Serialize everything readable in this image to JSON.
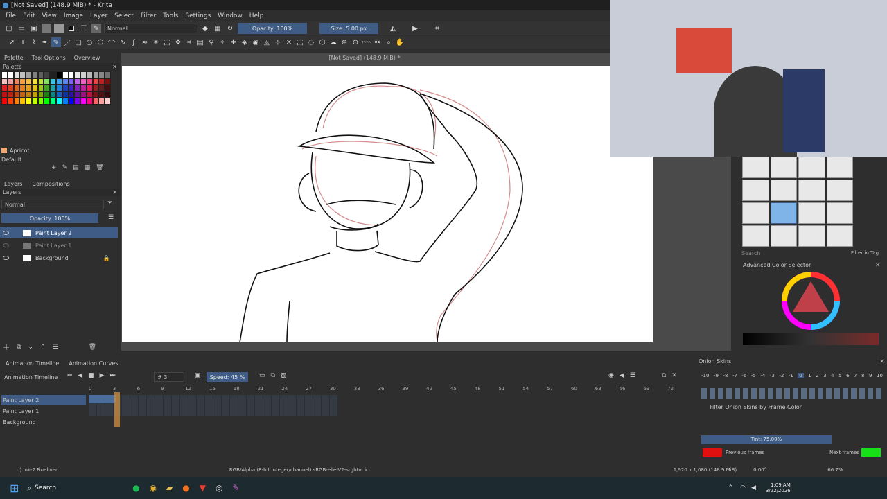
{
  "window_title": "[Not Saved] (148.9 MiB) * - Krita",
  "menu": [
    "File",
    "Edit",
    "View",
    "Image",
    "Layer",
    "Select",
    "Filter",
    "Tools",
    "Settings",
    "Window",
    "Help"
  ],
  "toolbar": {
    "blend_mode": "Normal",
    "opacity": "Opacity: 100%",
    "size": "Size: 5.00 px"
  },
  "docker_tabs": [
    "Palette",
    "Tool Options",
    "Overview"
  ],
  "palette": {
    "title": "Palette",
    "color_name": "Apricot",
    "palette_name": "Default"
  },
  "layers": {
    "tabs": [
      "Layers",
      "Compositions"
    ],
    "title": "Layers",
    "blend": "Normal",
    "opacity": "Opacity: 100%",
    "items": [
      {
        "name": "Paint Layer 2"
      },
      {
        "name": "Paint Layer 1"
      },
      {
        "name": "Background"
      }
    ]
  },
  "canvas": {
    "doc_title": "[Not Saved] (148.9 MiB) *"
  },
  "brushes": {
    "search": "Search",
    "filter_in_tag": "Filter in Tag"
  },
  "color_selector": {
    "title": "Advanced Color Selector"
  },
  "timeline": {
    "tabs": [
      "Animation Timeline",
      "Animation Curves"
    ],
    "title": "Animation Timeline",
    "frame": "# 3",
    "speed": "Speed: 45 %",
    "ruler": [
      "0",
      "3",
      "6",
      "9",
      "12",
      "15",
      "18",
      "21",
      "24",
      "27",
      "30",
      "33",
      "36",
      "39",
      "42",
      "45",
      "48",
      "51",
      "54",
      "57",
      "60",
      "63",
      "66",
      "69",
      "72"
    ],
    "layers": [
      "Paint Layer 2",
      "Paint Layer 1",
      "Background"
    ]
  },
  "onion": {
    "title": "Onion Skins",
    "numbers": [
      "-10",
      "-9",
      "-8",
      "-7",
      "-6",
      "-5",
      "-4",
      "-3",
      "-2",
      "-1",
      "0",
      "1",
      "2",
      "3",
      "4",
      "5",
      "6",
      "7",
      "8",
      "9",
      "10"
    ],
    "filter": "Filter Onion Skins by Frame Color",
    "tint": "Tint: 75.00%",
    "previous": "Previous frames",
    "next": "Next frames"
  },
  "statusbar": {
    "brush": "d) Ink-2 Fineliner",
    "color": "RGB/Alpha (8-bit integer/channel)  sRGB-elle-V2-srgbtrc.icc",
    "size": "1,920 x 1,080 (148.9 MiB)",
    "angle": "0.00°",
    "zoom": "66.7%"
  },
  "taskbar": {
    "search": "Search",
    "time": "1:09 AM",
    "date": "3/22/2026"
  }
}
